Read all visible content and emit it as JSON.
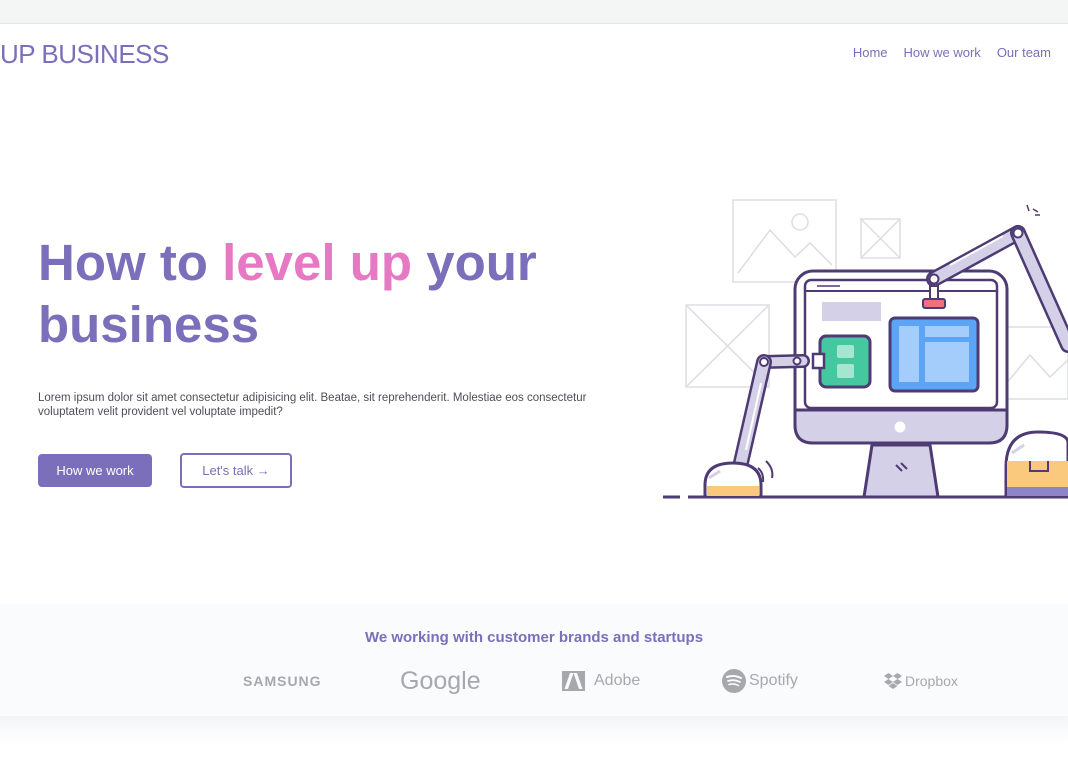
{
  "header": {
    "logo": "UP BUSINESS",
    "nav": [
      "Home",
      "How we work",
      "Our team"
    ]
  },
  "hero": {
    "title_part1": "How to ",
    "title_highlight": "level up",
    "title_part2": " your business",
    "description": "Lorem ipsum dolor sit amet consectetur adipisicing elit. Beatae, sit reprehenderit. Molestiae eos consectetur voluptatem velit provident vel voluptate impedit?",
    "primary_button": "How we work",
    "secondary_button": "Let's talk →"
  },
  "partners": {
    "title": "We working with customer brands and startups",
    "brands": [
      "SAMSUNG",
      "Google",
      "Adobe",
      "Spotify",
      "Dropbox"
    ]
  },
  "colors": {
    "accent": "#7b6fbb",
    "highlight": "#e778c4",
    "brand_logo_gray": "#a7a8ac"
  },
  "icons": {
    "illustration": "robot-arms-monitor-illustration",
    "arrow": "arrow-right-icon",
    "adobe": "adobe-logo-icon",
    "spotify": "spotify-logo-icon",
    "dropbox": "dropbox-logo-icon"
  }
}
